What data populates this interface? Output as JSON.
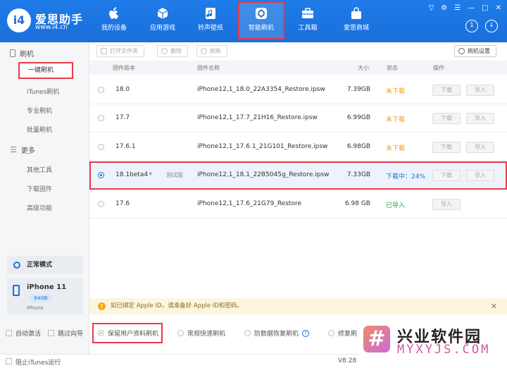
{
  "header": {
    "brand_name": "爱思助手",
    "brand_url": "www.i4.cn",
    "logo_text": "i4",
    "nav": [
      "我的设备",
      "应用游戏",
      "铃声壁纸",
      "智能刷机",
      "工具箱",
      "爱思商城"
    ],
    "notification_count": "1"
  },
  "sidebar": {
    "group_flash": "刷机",
    "items_flash": [
      "一键刷机",
      "iTunes刷机",
      "专业刷机",
      "批量刷机"
    ],
    "group_more": "更多",
    "items_more": [
      "其他工具",
      "下载固件",
      "高级功能"
    ],
    "mode": "正常模式",
    "device_name": "iPhone 11",
    "device_capacity": "64GB",
    "device_type": "iPhone"
  },
  "toolbar": {
    "open_folder": "打开文件夹",
    "delete": "删除",
    "refresh": "刷新",
    "settings": "刷机设置"
  },
  "table": {
    "headers": [
      "固件版本",
      "固件名称",
      "大小",
      "状态",
      "操作"
    ],
    "rows": [
      {
        "version": "18.0",
        "name": "iPhone12,1_18.0_22A3354_Restore.ipsw",
        "size": "7.39GB",
        "status": "未下载",
        "download": "下载",
        "import": "导入"
      },
      {
        "version": "17.7",
        "name": "iPhone12,1_17.7_21H16_Restore.ipsw",
        "size": "6.99GB",
        "status": "未下载",
        "download": "下载",
        "import": "导入"
      },
      {
        "version": "17.6.1",
        "name": "iPhone12,1_17.6.1_21G101_Restore.ipsw",
        "size": "6.98GB",
        "status": "未下载",
        "download": "下载",
        "import": "导入"
      },
      {
        "version": "18.1beta4",
        "tag": "测试版",
        "name": "iPhone12,1_18.1_22B5045g_Restore.ipsw",
        "size": "7.33GB",
        "status": "下载中：24%",
        "download": "下载",
        "import": "导入"
      },
      {
        "version": "17.6",
        "name": "iPhone12,1_17.6_21G79_Restore",
        "size": "6.98 GB",
        "status": "已导入",
        "import": "导入"
      }
    ]
  },
  "notice": "如已绑定 Apple ID，请准备好 Apple ID和密码。",
  "options": {
    "auto_activate": "自动激活",
    "skip_guide": "跳过向导",
    "preserve_data": "保留用户资料刷机",
    "quick_flash": "常规快速刷机",
    "recovery_flash": "防数据恢复刷机",
    "repair_flash": "修复刷"
  },
  "footer": {
    "block_itunes": "阻止iTunes运行",
    "version": "V8.28"
  },
  "watermark": {
    "cn": "兴业软件园",
    "en": "MYXYJS.COM"
  }
}
